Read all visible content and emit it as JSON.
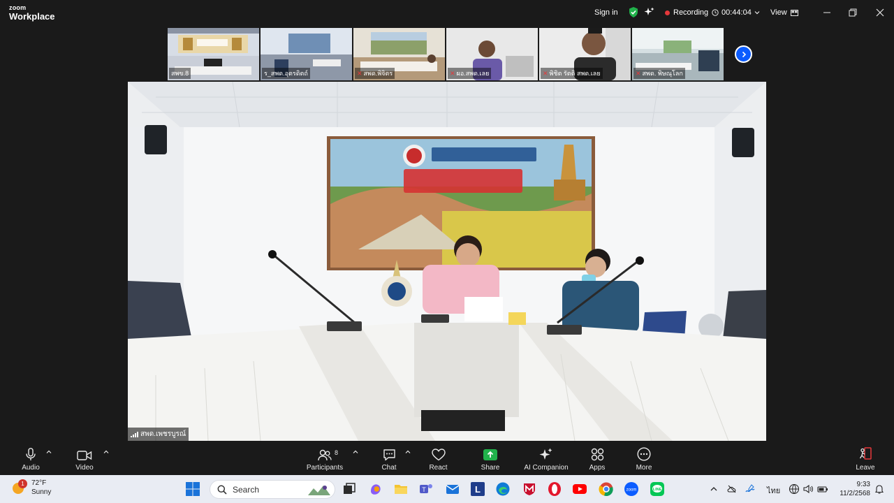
{
  "app": {
    "brand_top": "zoom",
    "brand_bottom": "Workplace"
  },
  "titlebar": {
    "sign_in": "Sign in",
    "recording": "Recording",
    "timer": "00:44:04",
    "view": "View"
  },
  "thumbnails": [
    {
      "name": "สพข.8",
      "muted": false
    },
    {
      "name": "ร_สพด.อุตรดิตถ์",
      "muted": false
    },
    {
      "name": "สพด.พิจิตร",
      "muted": true
    },
    {
      "name": "ผอ.สพด.เลย",
      "muted": true
    },
    {
      "name": "พิชิต รัตติ สพด.เลย",
      "muted": true
    },
    {
      "name": "สพด. พิษณุโลก",
      "muted": true
    }
  ],
  "main": {
    "speaker": "สพด.เพชรบูรณ์"
  },
  "toolbar": {
    "audio": "Audio",
    "video": "Video",
    "participants": "Participants",
    "participants_count": "8",
    "chat": "Chat",
    "react": "React",
    "share": "Share",
    "ai_companion": "AI Companion",
    "apps": "Apps",
    "more": "More",
    "leave": "Leave"
  },
  "taskbar": {
    "weather_temp": "72°F",
    "weather_cond": "Sunny",
    "weather_badge": "1",
    "search_placeholder": "Search",
    "lang": "ไทย",
    "time": "9:33",
    "date": "11/2/2568"
  },
  "colors": {
    "accent_blue": "#0b5cff",
    "recording_red": "#e5383b",
    "share_green": "#21b24b"
  }
}
